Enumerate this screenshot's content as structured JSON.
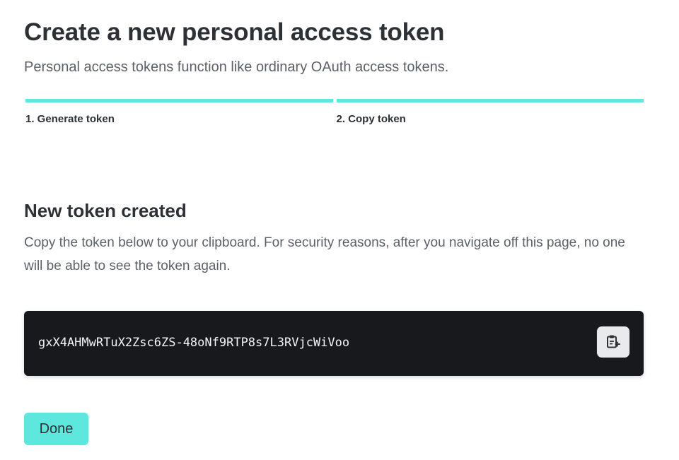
{
  "header": {
    "title": "Create a new personal access token",
    "subtitle": "Personal access tokens function like ordinary OAuth access tokens."
  },
  "steps": [
    {
      "label": "1. Generate token"
    },
    {
      "label": "2. Copy token"
    }
  ],
  "section": {
    "title": "New token created",
    "description": "Copy the token below to your clipboard. For security reasons, after you navigate off this page, no one will be able to see the token again."
  },
  "token": {
    "value": "gxX4AHMwRTuX2Zsc6ZS-48oNf9RTP8s7L3RVjcWiVoo",
    "copy_icon": "clipboard-copy-icon"
  },
  "actions": {
    "done_label": "Done"
  },
  "colors": {
    "accent": "#5ee7dc",
    "token_background": "#17191c",
    "text_primary": "#2d3035",
    "text_secondary": "#5c6168"
  }
}
